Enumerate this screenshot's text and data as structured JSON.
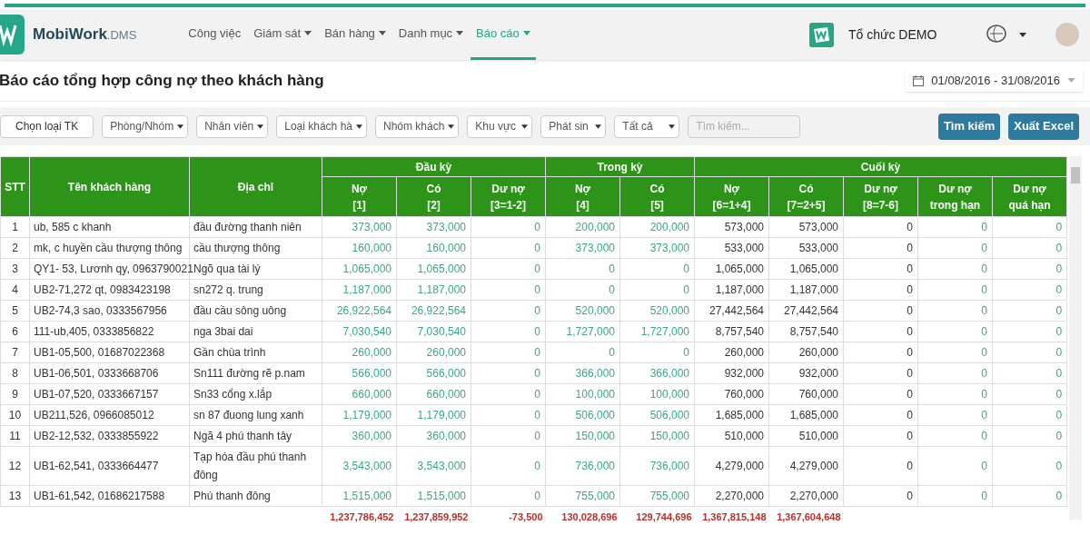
{
  "brand": {
    "name": "MobiWork",
    "suffix": ".DMS"
  },
  "nav": [
    {
      "label": "Công việc",
      "dropdown": false,
      "selected": false
    },
    {
      "label": "Giám sát",
      "dropdown": true,
      "selected": false
    },
    {
      "label": "Bán hàng",
      "dropdown": true,
      "selected": false
    },
    {
      "label": "Danh mục",
      "dropdown": true,
      "selected": false
    },
    {
      "label": "Báo cáo",
      "dropdown": true,
      "selected": true
    }
  ],
  "organization": "Tổ chức DEMO",
  "page_title": "Báo cáo tổng hợp công nợ theo khách hàng",
  "date_range": "01/08/2016 - 31/08/2016",
  "filters": [
    {
      "kind": "button",
      "label": "Chọn loại TK"
    },
    {
      "kind": "select",
      "label": "Phòng/Nhóm"
    },
    {
      "kind": "select",
      "label": "Nhân viên"
    },
    {
      "kind": "select",
      "label": "Loại khách hà"
    },
    {
      "kind": "select",
      "label": "Nhóm khách"
    },
    {
      "kind": "select",
      "label": "Khu vực"
    },
    {
      "kind": "select",
      "label": "Phát sin"
    },
    {
      "kind": "select",
      "label": "Tất cả"
    },
    {
      "kind": "search",
      "placeholder": "Tìm kiếm..."
    }
  ],
  "actions": [
    "Tìm kiếm",
    "Xuất Excel"
  ],
  "table": {
    "columns": [
      "STT",
      "Tên khách hàng",
      "Địa chỉ"
    ],
    "groups": [
      {
        "label": "Đầu kỳ",
        "columns": [
          [
            "Nợ",
            "[1]"
          ],
          [
            "Có",
            "[2]"
          ],
          [
            "Dư nợ",
            "[3=1-2]"
          ]
        ]
      },
      {
        "label": "Trong kỳ",
        "columns": [
          [
            "Nợ",
            "[4]"
          ],
          [
            "Có",
            "[5]"
          ]
        ]
      },
      {
        "label": "Cuối kỳ",
        "columns": [
          [
            "Nợ",
            "[6=1+4]"
          ],
          [
            "Có",
            "[7=2+5]"
          ],
          [
            "Dư nợ",
            "[8=7-6]"
          ],
          [
            "Dư nợ",
            "trong hạn"
          ],
          [
            "Dư nợ",
            "quá hạn"
          ]
        ]
      }
    ],
    "rows": [
      {
        "stt": "1",
        "name": "ub, 585 c khanh",
        "address": "đầu đường thanh niên",
        "values": [
          "373,000",
          "373,000",
          "0",
          "200,000",
          "200,000",
          "573,000",
          "573,000",
          "0",
          "0",
          "0"
        ]
      },
      {
        "stt": "2",
        "name": "mk, c huyền cầu thượng thông",
        "address": "cầu thượng thông",
        "values": [
          "160,000",
          "160,000",
          "0",
          "373,000",
          "373,000",
          "533,000",
          "533,000",
          "0",
          "0",
          "0"
        ]
      },
      {
        "stt": "3",
        "name": "QY1- 53, Lươnh qy, 0963790021",
        "address": "Ngõ qua tài lý",
        "values": [
          "1,065,000",
          "1,065,000",
          "0",
          "0",
          "0",
          "1,065,000",
          "1,065,000",
          "0",
          "0",
          "0"
        ]
      },
      {
        "stt": "4",
        "name": "UB2-71,272 qt, 0983423198",
        "address": "sn272 q. trung",
        "values": [
          "1,187,000",
          "1,187,000",
          "0",
          "0",
          "0",
          "1,187,000",
          "1,187,000",
          "0",
          "0",
          "0"
        ]
      },
      {
        "stt": "5",
        "name": "UB2-74,3 sao, 0333567956",
        "address": "đầu cầu sông uông",
        "values": [
          "26,922,564",
          "26,922,564",
          "0",
          "520,000",
          "520,000",
          "27,442,564",
          "27,442,564",
          "0",
          "0",
          "0"
        ]
      },
      {
        "stt": "6",
        "name": "111-ub,405, 0333856822",
        "address": "nga 3bai dai",
        "values": [
          "7,030,540",
          "7,030,540",
          "0",
          "1,727,000",
          "1,727,000",
          "8,757,540",
          "8,757,540",
          "0",
          "0",
          "0"
        ]
      },
      {
        "stt": "7",
        "name": "UB1-05,500, 01687022368",
        "address": "Gần chùa trình",
        "values": [
          "260,000",
          "260,000",
          "0",
          "0",
          "0",
          "260,000",
          "260,000",
          "0",
          "0",
          "0"
        ]
      },
      {
        "stt": "8",
        "name": "UB1-06,501, 0333668706",
        "address": "Sn111 đường rẽ p.nam",
        "values": [
          "566,000",
          "566,000",
          "0",
          "366,000",
          "366,000",
          "932,000",
          "932,000",
          "0",
          "0",
          "0"
        ]
      },
      {
        "stt": "9",
        "name": "UB1-07,520, 0333667157",
        "address": "Sn33 cổng x.lắp",
        "values": [
          "660,000",
          "660,000",
          "0",
          "100,000",
          "100,000",
          "760,000",
          "760,000",
          "0",
          "0",
          "0"
        ]
      },
      {
        "stt": "10",
        "name": "UB211,526, 0966085012",
        "address": "sn 87 đuong lung xanh",
        "values": [
          "1,179,000",
          "1,179,000",
          "0",
          "506,000",
          "506,000",
          "1,685,000",
          "1,685,000",
          "0",
          "0",
          "0"
        ]
      },
      {
        "stt": "11",
        "name": "UB2-12,532, 0333855922",
        "address": "Ngã 4 phú thanh tây",
        "values": [
          "360,000",
          "360,000",
          "0",
          "150,000",
          "150,000",
          "510,000",
          "510,000",
          "0",
          "0",
          "0"
        ]
      },
      {
        "stt": "12",
        "name": "UB1-62,541, 0333664477",
        "address": "Tạp hóa đầu phú thanh đông",
        "values": [
          "3,543,000",
          "3,543,000",
          "0",
          "736,000",
          "736,000",
          "4,279,000",
          "4,279,000",
          "0",
          "0",
          "0"
        ]
      },
      {
        "stt": "13",
        "name": "UB1-61,542, 01686217588",
        "address": "Phú thanh đông",
        "values": [
          "1,515,000",
          "1,515,000",
          "0",
          "755,000",
          "755,000",
          "2,270,000",
          "2,270,000",
          "0",
          "0",
          "0"
        ]
      }
    ],
    "totals": [
      "1,237,786,452",
      "1,237,859,952",
      "-73,500",
      "130,028,696",
      "129,744,696",
      "1,367,815,148",
      "1,367,604,648"
    ]
  }
}
